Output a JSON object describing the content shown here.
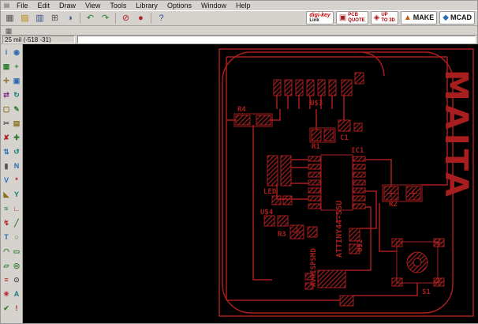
{
  "colors": {
    "chrome": "#d6d3ce",
    "copper": "#a81e1e",
    "canvas_bg": "#000000"
  },
  "menubar": {
    "window_icon": "▤",
    "items": [
      "File",
      "Edit",
      "Draw",
      "View",
      "Tools",
      "Library",
      "Options",
      "Window",
      "Help"
    ]
  },
  "toolbar": {
    "icons": [
      {
        "name": "grid-icon",
        "glyph": "▦",
        "color": "#555555"
      },
      {
        "name": "open-icon",
        "glyph": "▤",
        "color": "#b8860b"
      },
      {
        "name": "save-icon",
        "glyph": "▥",
        "color": "#33508c"
      },
      {
        "name": "print-icon",
        "glyph": "⊞",
        "color": "#555555"
      },
      {
        "name": "cam-icon",
        "glyph": "◑",
        "color": "#33508c"
      },
      {
        "name": "undo-icon",
        "glyph": "↶",
        "color": "#2f7d32"
      },
      {
        "name": "redo-icon",
        "glyph": "↷",
        "color": "#2f7d32"
      },
      {
        "name": "stop-icon",
        "glyph": "⊘",
        "color": "#b02020"
      },
      {
        "name": "record-icon",
        "glyph": "●",
        "color": "#b02020"
      },
      {
        "name": "help-icon",
        "glyph": "?",
        "color": "#33508c"
      }
    ],
    "brand": {
      "digikey": {
        "line1": "digi-key",
        "line2": "Link"
      },
      "pcb_quote": {
        "icon": "▣",
        "line1": "PCB",
        "line2": "QUOTE"
      },
      "up_to_3d": {
        "icon": "◈",
        "line1": "UP",
        "line2": "TO 3D"
      },
      "make": {
        "icon": "▲",
        "label": "MAKE"
      },
      "mcad": {
        "icon": "◆",
        "label": "MCAD"
      }
    }
  },
  "secondbar": {
    "grid_glyph": "▦"
  },
  "coordbar": {
    "coords": "25 mil (-518 -31)",
    "command_value": ""
  },
  "sidebar": {
    "tools": [
      {
        "name": "info-tool",
        "glyph": "i",
        "color": "#2b6cb0"
      },
      {
        "name": "show-tool",
        "glyph": "◉",
        "color": "#2b6cb0"
      },
      {
        "name": "display-tool",
        "glyph": "▦",
        "color": "#2f7d32"
      },
      {
        "name": "mark-tool",
        "glyph": "+",
        "color": "#2f7d32"
      },
      {
        "name": "move-tool",
        "glyph": "✛",
        "color": "#8a6d1a"
      },
      {
        "name": "copy-tool",
        "glyph": "▣",
        "color": "#2b6cb0"
      },
      {
        "name": "mirror-tool",
        "glyph": "⇄",
        "color": "#7b2d8b"
      },
      {
        "name": "rotate-tool",
        "glyph": "↻",
        "color": "#0f7b7b"
      },
      {
        "name": "group-tool",
        "glyph": "▢",
        "color": "#8a6d1a"
      },
      {
        "name": "change-tool",
        "glyph": "✎",
        "color": "#2f7d32"
      },
      {
        "name": "cut-tool",
        "glyph": "✂",
        "color": "#555555"
      },
      {
        "name": "paste-tool",
        "glyph": "▤",
        "color": "#8a6d1a"
      },
      {
        "name": "delete-tool",
        "glyph": "✘",
        "color": "#b02020"
      },
      {
        "name": "add-tool",
        "glyph": "✚",
        "color": "#2f7d32"
      },
      {
        "name": "pinswap-tool",
        "glyph": "⇅",
        "color": "#2b6cb0"
      },
      {
        "name": "replace-tool",
        "glyph": "↺",
        "color": "#0f7b7b"
      },
      {
        "name": "lock-tool",
        "glyph": "▮",
        "color": "#555555"
      },
      {
        "name": "name-tool",
        "glyph": "N",
        "color": "#2b6cb0"
      },
      {
        "name": "value-tool",
        "glyph": "V",
        "color": "#2b6cb0"
      },
      {
        "name": "smash-tool",
        "glyph": "*",
        "color": "#b02020"
      },
      {
        "name": "miter-tool",
        "glyph": "◣",
        "color": "#8a6d1a"
      },
      {
        "name": "split-tool",
        "glyph": "Y",
        "color": "#0f7b7b"
      },
      {
        "name": "optimize-tool",
        "glyph": "≈",
        "color": "#2f7d32"
      },
      {
        "name": "route-tool",
        "glyph": "∟",
        "color": "#b02020"
      },
      {
        "name": "ripup-tool",
        "glyph": "↯",
        "color": "#b02020"
      },
      {
        "name": "wire-tool",
        "glyph": "╱",
        "color": "#2f7d32"
      },
      {
        "name": "text-tool",
        "glyph": "T",
        "color": "#2b6cb0"
      },
      {
        "name": "circle-tool",
        "glyph": "○",
        "color": "#2f7d32"
      },
      {
        "name": "arc-tool",
        "glyph": "◠",
        "color": "#2f7d32"
      },
      {
        "name": "rect-tool",
        "glyph": "▭",
        "color": "#2f7d32"
      },
      {
        "name": "polygon-tool",
        "glyph": "▱",
        "color": "#2f7d32"
      },
      {
        "name": "via-tool",
        "glyph": "◎",
        "color": "#2f7d32"
      },
      {
        "name": "signal-tool",
        "glyph": "≡",
        "color": "#b02020"
      },
      {
        "name": "hole-tool",
        "glyph": "⊙",
        "color": "#555555"
      },
      {
        "name": "ratsnest-tool",
        "glyph": "✳",
        "color": "#b02020"
      },
      {
        "name": "auto-tool",
        "glyph": "A",
        "color": "#0f7b7b"
      },
      {
        "name": "drc-tool",
        "glyph": "✔",
        "color": "#2f7d32"
      },
      {
        "name": "errors-tool",
        "glyph": "!",
        "color": "#b02020"
      }
    ]
  },
  "canvas": {
    "labels": {
      "u3": "U$3",
      "r4": "R4",
      "r1": "R1",
      "c1": "C1",
      "ic1": "IC1",
      "led": "LED",
      "u4": "U$4",
      "r3": "R3",
      "r2": "R2",
      "u2": "U$2",
      "s1": "S1",
      "avrisp": "AVRISPSMD",
      "attiny": "ATTINY44-SSU",
      "brand": "MAITA"
    }
  }
}
